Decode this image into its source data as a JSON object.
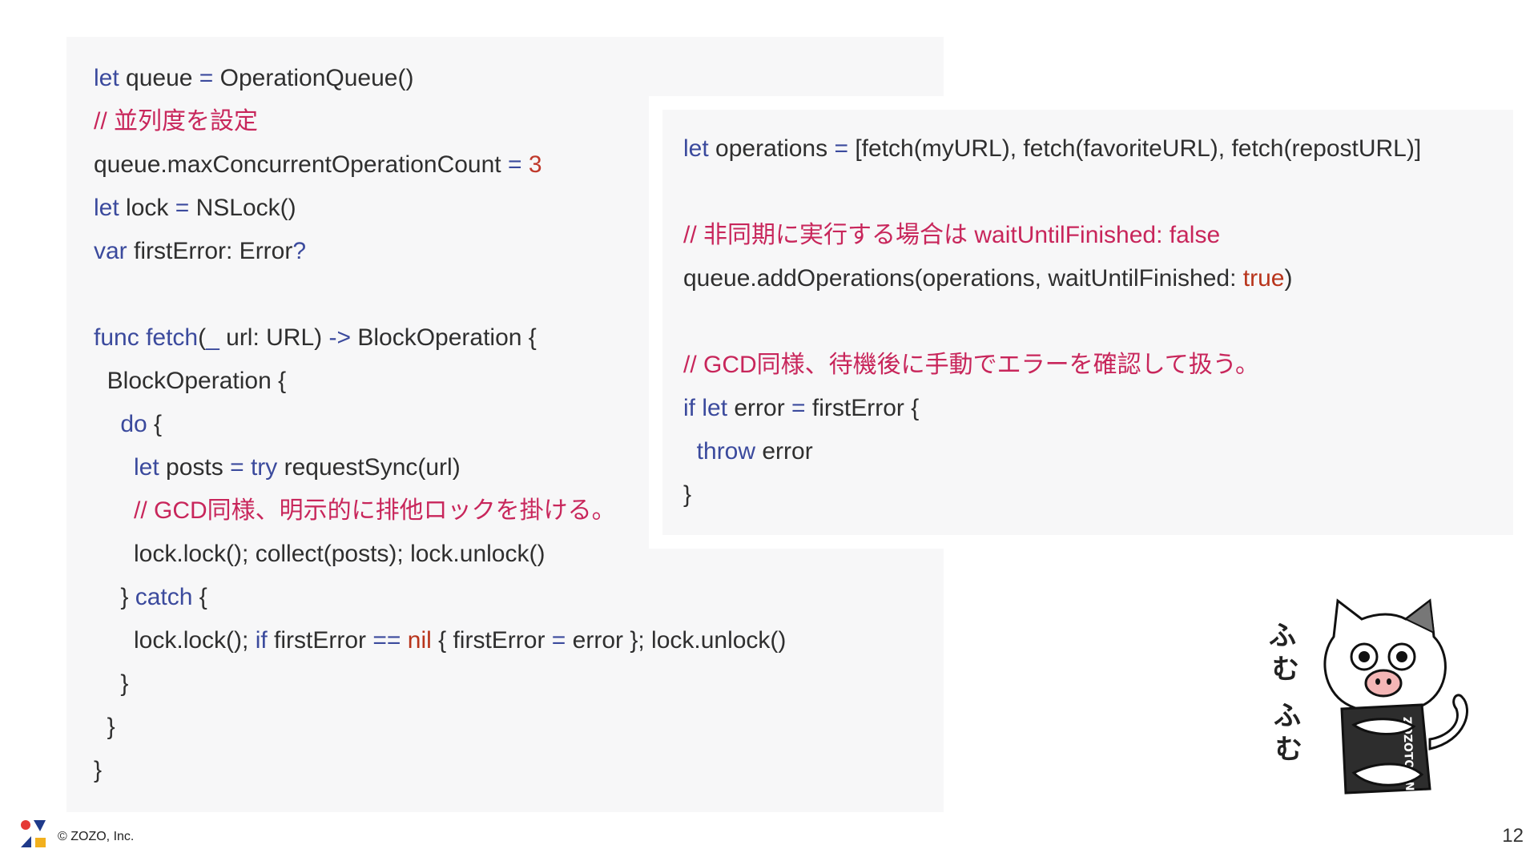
{
  "slide": {
    "copyright": "© ZOZO, Inc.",
    "page_number": "12",
    "mascot_caption": [
      "ふ",
      "む",
      "ふ",
      "む"
    ],
    "mascot_box_text": "ZOZOTOWN",
    "colors": {
      "background": "#ffffff",
      "code_background": "#f7f7f8",
      "keyword": "#3b4a9d",
      "comment": "#c8265b",
      "literal": "#c0392b",
      "text": "#2f2f2f",
      "logo_red": "#e53935",
      "logo_blue": "#1f3a8a",
      "logo_yellow": "#f2b01e"
    }
  },
  "code_left": {
    "lines": [
      [
        {
          "t": "kw",
          "v": "let"
        },
        {
          "t": "tx",
          "v": " queue "
        },
        {
          "t": "kw",
          "v": "="
        },
        {
          "t": "tx",
          "v": " OperationQueue()"
        }
      ],
      [
        {
          "t": "cm",
          "v": "// 並列度を設定"
        }
      ],
      [
        {
          "t": "tx",
          "v": "queue.maxConcurrentOperationCount "
        },
        {
          "t": "kw",
          "v": "="
        },
        {
          "t": "tx",
          "v": " "
        },
        {
          "t": "num",
          "v": "3"
        }
      ],
      [
        {
          "t": "kw",
          "v": "let"
        },
        {
          "t": "tx",
          "v": " lock "
        },
        {
          "t": "kw",
          "v": "="
        },
        {
          "t": "tx",
          "v": " NSLock()"
        }
      ],
      [
        {
          "t": "kw",
          "v": "var"
        },
        {
          "t": "tx",
          "v": " firstError: Error"
        },
        {
          "t": "kw",
          "v": "?"
        }
      ],
      [],
      [
        {
          "t": "kw",
          "v": "func"
        },
        {
          "t": "tx",
          "v": " "
        },
        {
          "t": "kw",
          "v": "fetch"
        },
        {
          "t": "tx",
          "v": "("
        },
        {
          "t": "kw",
          "v": "_"
        },
        {
          "t": "tx",
          "v": " url: URL) "
        },
        {
          "t": "kw",
          "v": "->"
        },
        {
          "t": "tx",
          "v": " BlockOperation {"
        }
      ],
      [
        {
          "t": "tx",
          "v": "  BlockOperation {"
        }
      ],
      [
        {
          "t": "tx",
          "v": "    "
        },
        {
          "t": "kw",
          "v": "do"
        },
        {
          "t": "tx",
          "v": " {"
        }
      ],
      [
        {
          "t": "tx",
          "v": "      "
        },
        {
          "t": "kw",
          "v": "let"
        },
        {
          "t": "tx",
          "v": " posts "
        },
        {
          "t": "kw",
          "v": "="
        },
        {
          "t": "tx",
          "v": " "
        },
        {
          "t": "kw",
          "v": "try"
        },
        {
          "t": "tx",
          "v": " requestSync(url)"
        }
      ],
      [
        {
          "t": "tx",
          "v": "      "
        },
        {
          "t": "cm",
          "v": "// GCD同様、明示的に排他ロックを掛ける。"
        }
      ],
      [
        {
          "t": "tx",
          "v": "      lock.lock(); collect(posts); lock.unlock()"
        }
      ],
      [
        {
          "t": "tx",
          "v": "    } "
        },
        {
          "t": "kw",
          "v": "catch"
        },
        {
          "t": "tx",
          "v": " {"
        }
      ],
      [
        {
          "t": "tx",
          "v": "      lock.lock(); "
        },
        {
          "t": "kw",
          "v": "if"
        },
        {
          "t": "tx",
          "v": " firstError "
        },
        {
          "t": "kw",
          "v": "=="
        },
        {
          "t": "tx",
          "v": " "
        },
        {
          "t": "lit",
          "v": "nil"
        },
        {
          "t": "tx",
          "v": " { firstError "
        },
        {
          "t": "kw",
          "v": "="
        },
        {
          "t": "tx",
          "v": " error }; lock.unlock()"
        }
      ],
      [
        {
          "t": "tx",
          "v": "    }"
        }
      ],
      [
        {
          "t": "tx",
          "v": "  }"
        }
      ],
      [
        {
          "t": "tx",
          "v": "}"
        }
      ]
    ]
  },
  "code_right": {
    "lines": [
      [
        {
          "t": "kw",
          "v": "let"
        },
        {
          "t": "tx",
          "v": " operations "
        },
        {
          "t": "kw",
          "v": "="
        },
        {
          "t": "tx",
          "v": " [fetch(myURL), fetch(favoriteURL), fetch(repostURL)]"
        }
      ],
      [],
      [
        {
          "t": "cm",
          "v": "// 非同期に実行する場合は waitUntilFinished: false"
        }
      ],
      [
        {
          "t": "tx",
          "v": "queue.addOperations(operations, waitUntilFinished: "
        },
        {
          "t": "lit",
          "v": "true"
        },
        {
          "t": "tx",
          "v": ")"
        }
      ],
      [],
      [
        {
          "t": "cm",
          "v": "// GCD同様、待機後に手動でエラーを確認して扱う。"
        }
      ],
      [
        {
          "t": "kw",
          "v": "if"
        },
        {
          "t": "tx",
          "v": " "
        },
        {
          "t": "kw",
          "v": "let"
        },
        {
          "t": "tx",
          "v": " error "
        },
        {
          "t": "kw",
          "v": "="
        },
        {
          "t": "tx",
          "v": " firstError {"
        }
      ],
      [
        {
          "t": "tx",
          "v": "  "
        },
        {
          "t": "kw",
          "v": "throw"
        },
        {
          "t": "tx",
          "v": " error"
        }
      ],
      [
        {
          "t": "tx",
          "v": "}"
        }
      ]
    ]
  }
}
